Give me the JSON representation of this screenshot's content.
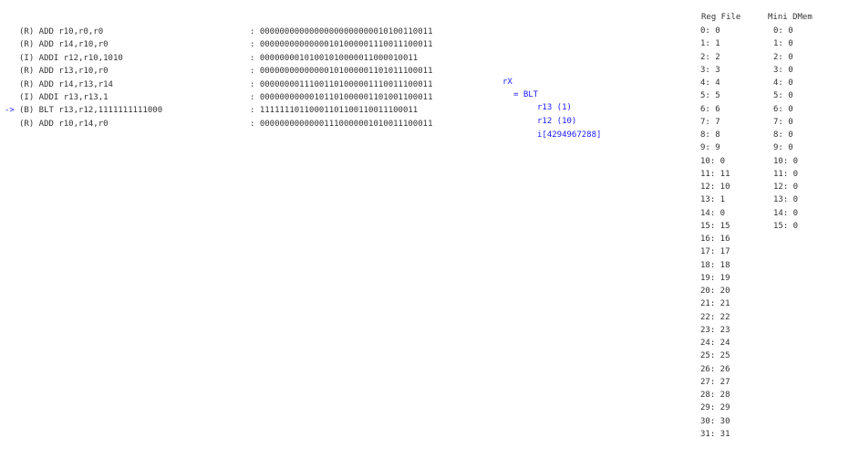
{
  "instructions": [
    {
      "pointer": "",
      "text": "(R) ADD r10,r0,r0",
      "binary": ": 00000000000000000000000010100110011"
    },
    {
      "pointer": "",
      "text": "(R) ADD r14,r10,r0",
      "binary": ": 00000000000000101000001110011100011"
    },
    {
      "pointer": "",
      "text": "(I) ADDI r12,r10,1010",
      "binary": ": 00000000101001010000011000010011"
    },
    {
      "pointer": "",
      "text": "(R) ADD r13,r10,r0",
      "binary": ": 00000000000000101000001101011100011"
    },
    {
      "pointer": "",
      "text": "(R) ADD r14,r13,r14",
      "binary": ": 00000000111001101000001110011100011"
    },
    {
      "pointer": "",
      "text": "(I) ADDI r13,r13,1",
      "binary": ": 00000000000101101000001101001100011"
    },
    {
      "pointer": "->",
      "text": "(B) BLT r13,r12,1111111111000",
      "binary": ": 11111110110001101100110011100011"
    },
    {
      "pointer": "",
      "text": "(R) ADD r10,r14,r0",
      "binary": ": 00000000000001110000001010011100011"
    }
  ],
  "tree": {
    "root": "rX",
    "op": "= BLT",
    "children": [
      "r13 (1)",
      "r12 (10)",
      "i[4294967288]"
    ]
  },
  "reg_file": {
    "title": "Reg File",
    "rows": [
      "0: 0",
      "1: 1",
      "2: 2",
      "3: 3",
      "4: 4",
      "5: 5",
      "6: 6",
      "7: 7",
      "8: 8",
      "9: 9",
      "10: 0",
      "11: 11",
      "12: 10",
      "13: 1",
      "14: 0",
      "15: 15",
      "16: 16",
      "17: 17",
      "18: 18",
      "19: 19",
      "20: 20",
      "21: 21",
      "22: 22",
      "23: 23",
      "24: 24",
      "25: 25",
      "26: 26",
      "27: 27",
      "28: 28",
      "29: 29",
      "30: 30",
      "31: 31"
    ]
  },
  "mini_dmem": {
    "title": "Mini DMem",
    "rows": [
      "0: 0",
      "1: 0",
      "2: 0",
      "3: 0",
      "4: 0",
      "5: 0",
      "6: 0",
      "7: 0",
      "8: 0",
      "9: 0",
      "10: 0",
      "11: 0",
      "12: 0",
      "13: 0",
      "14: 0",
      "15: 0"
    ]
  },
  "colors": {
    "text": "#333333",
    "highlight": "#1a1aff"
  }
}
